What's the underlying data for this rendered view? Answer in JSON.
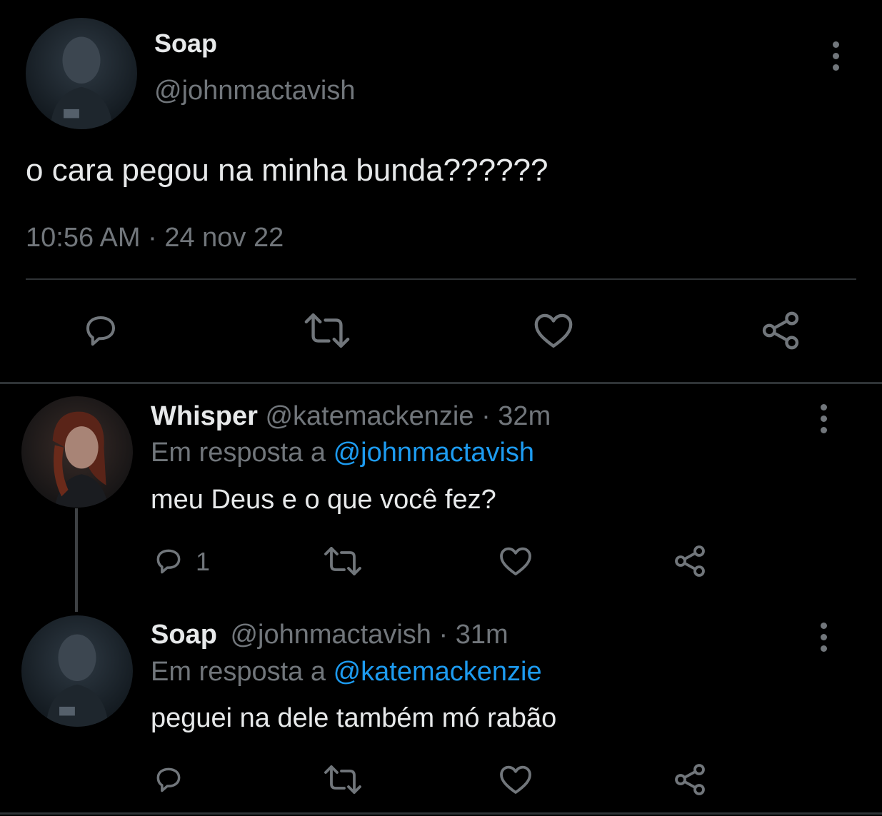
{
  "main_tweet": {
    "author_name": "Soap",
    "author_handle": "@johnmactavish",
    "text": "o cara pegou na minha bunda??????",
    "time": "10:56 AM",
    "date_separator": "·",
    "date": "24 nov 22"
  },
  "replies": [
    {
      "author_name": "Whisper",
      "author_handle": "@katemackenzie",
      "separator": "·",
      "time_ago": "32m",
      "reply_prefix": "Em resposta a",
      "reply_to": "@johnmactavish",
      "text": "meu Deus e o que você fez?",
      "reply_count": "1"
    },
    {
      "author_name": "Soap",
      "author_handle": "@johnmactavish",
      "separator": "·",
      "time_ago": "31m",
      "reply_prefix": "Em resposta a",
      "reply_to": "@katemackenzie",
      "text": "peguei na dele também mó rabão",
      "reply_count": ""
    }
  ],
  "icons": {
    "reply": "reply-icon",
    "retweet": "retweet-icon",
    "like": "heart-icon",
    "share": "share-icon",
    "more": "more-vertical-icon"
  },
  "colors": {
    "background": "#000000",
    "text": "#e7e9ea",
    "muted": "#71767b",
    "link": "#1d9bf0",
    "divider": "#2f3336"
  }
}
